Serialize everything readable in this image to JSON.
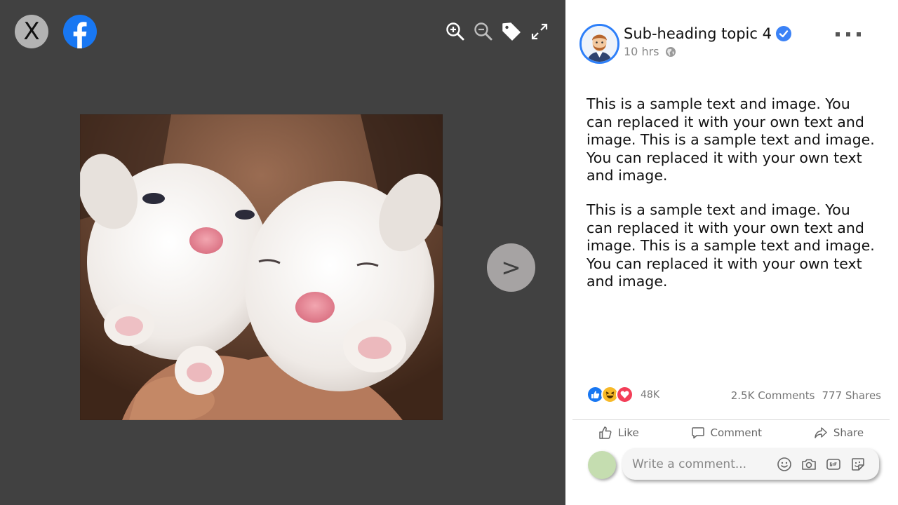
{
  "viewer": {
    "close_label": "X",
    "next_label": ">",
    "photo_alt": "Two white puppies"
  },
  "post": {
    "title": "Sub-heading topic 4",
    "time": "10 hrs",
    "paragraphs": [
      "This is a sample text and image. You can replaced it with your own text and image. This is a sample text and image. You can replaced it with your own text and image.",
      "This is a sample text and image. You can replaced it with your own text and image. This is a sample text and image. You can replaced it with your own text and image."
    ],
    "reaction_count": "48K",
    "comments_count": "2.5K Comments",
    "shares_count": "777 Shares"
  },
  "actions": {
    "like": "Like",
    "comment": "Comment",
    "share": "Share"
  },
  "comment_box": {
    "placeholder": "Write a comment..."
  },
  "colors": {
    "viewer_bg": "#414141",
    "facebook_blue": "#1877f2",
    "verified_blue": "#3b82f6"
  }
}
